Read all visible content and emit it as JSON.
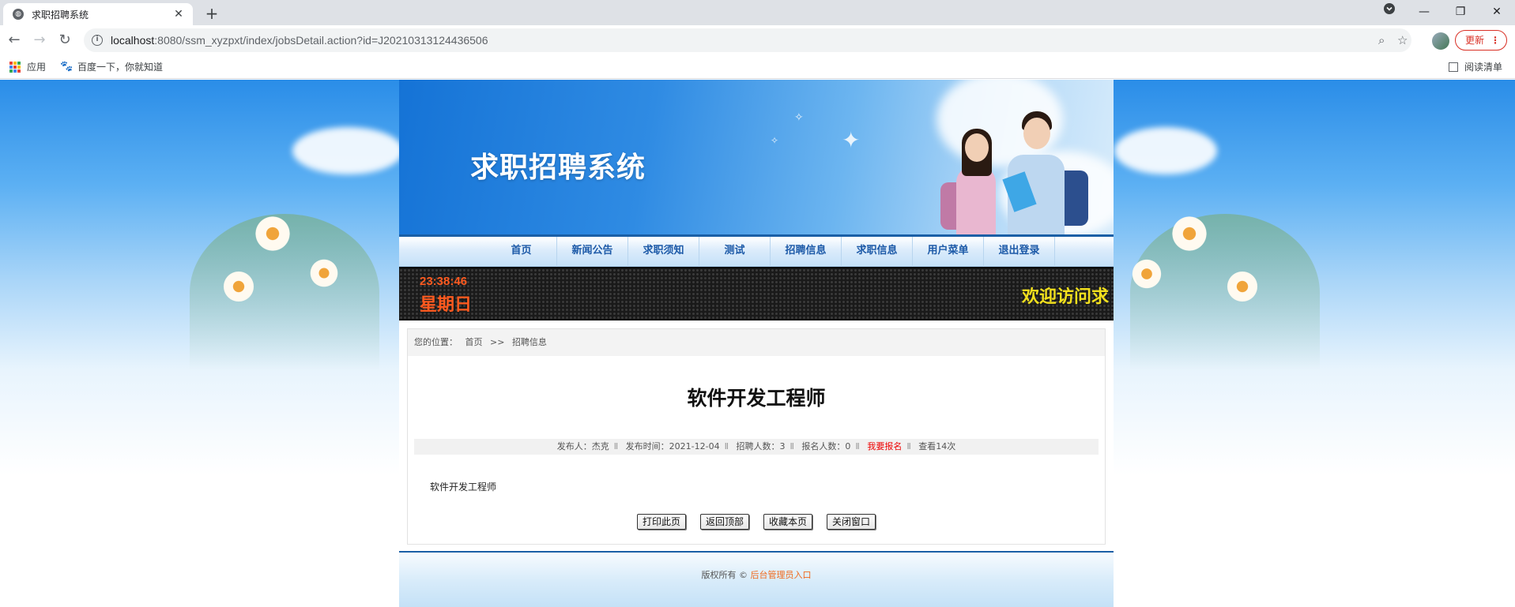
{
  "browser": {
    "tab_title": "求职招聘系统",
    "tab_close": "✕",
    "new_tab": "+",
    "url_host": "localhost",
    "url_rest": ":8080/ssm_xyzpxt/index/jobsDetail.action?id=J20210313124436506",
    "update_label": "更新",
    "bookmarks": {
      "apps": "应用",
      "baidu": "百度一下，你就知道",
      "reading_list": "阅读清单"
    }
  },
  "site": {
    "title": "求职招聘系统",
    "nav": [
      "首页",
      "新闻公告",
      "求职须知",
      "测试",
      "招聘信息",
      "求职信息",
      "用户菜单",
      "退出登录"
    ],
    "ticker": {
      "time": "23:38:46",
      "weekday": "星期日",
      "marquee": "欢迎访问求"
    },
    "breadcrumb": {
      "prefix": "您的位置：",
      "home": "首页",
      "sep": ">>",
      "current": "招聘信息"
    },
    "article": {
      "title": "软件开发工程师",
      "publisher": "发布人：杰克",
      "publish_time": "发布时间：2021-12-04",
      "hire_count": "招聘人数：3",
      "applicant_count": "报名人数：0",
      "apply_link": "我要报名",
      "views": "查看14次",
      "body": "软件开发工程师"
    },
    "actions": [
      "打印此页",
      "返回顶部",
      "收藏本页",
      "关闭窗口"
    ],
    "footer": {
      "copyright": "版权所有 © ",
      "admin_link": "后台管理员入口"
    }
  },
  "colors": {
    "nav_text": "#1d5aa8",
    "ticker_clock": "#ff5a1f",
    "ticker_marquee": "#f2e01d",
    "apply_link": "#ee0000",
    "admin_link": "#f06a1b"
  }
}
